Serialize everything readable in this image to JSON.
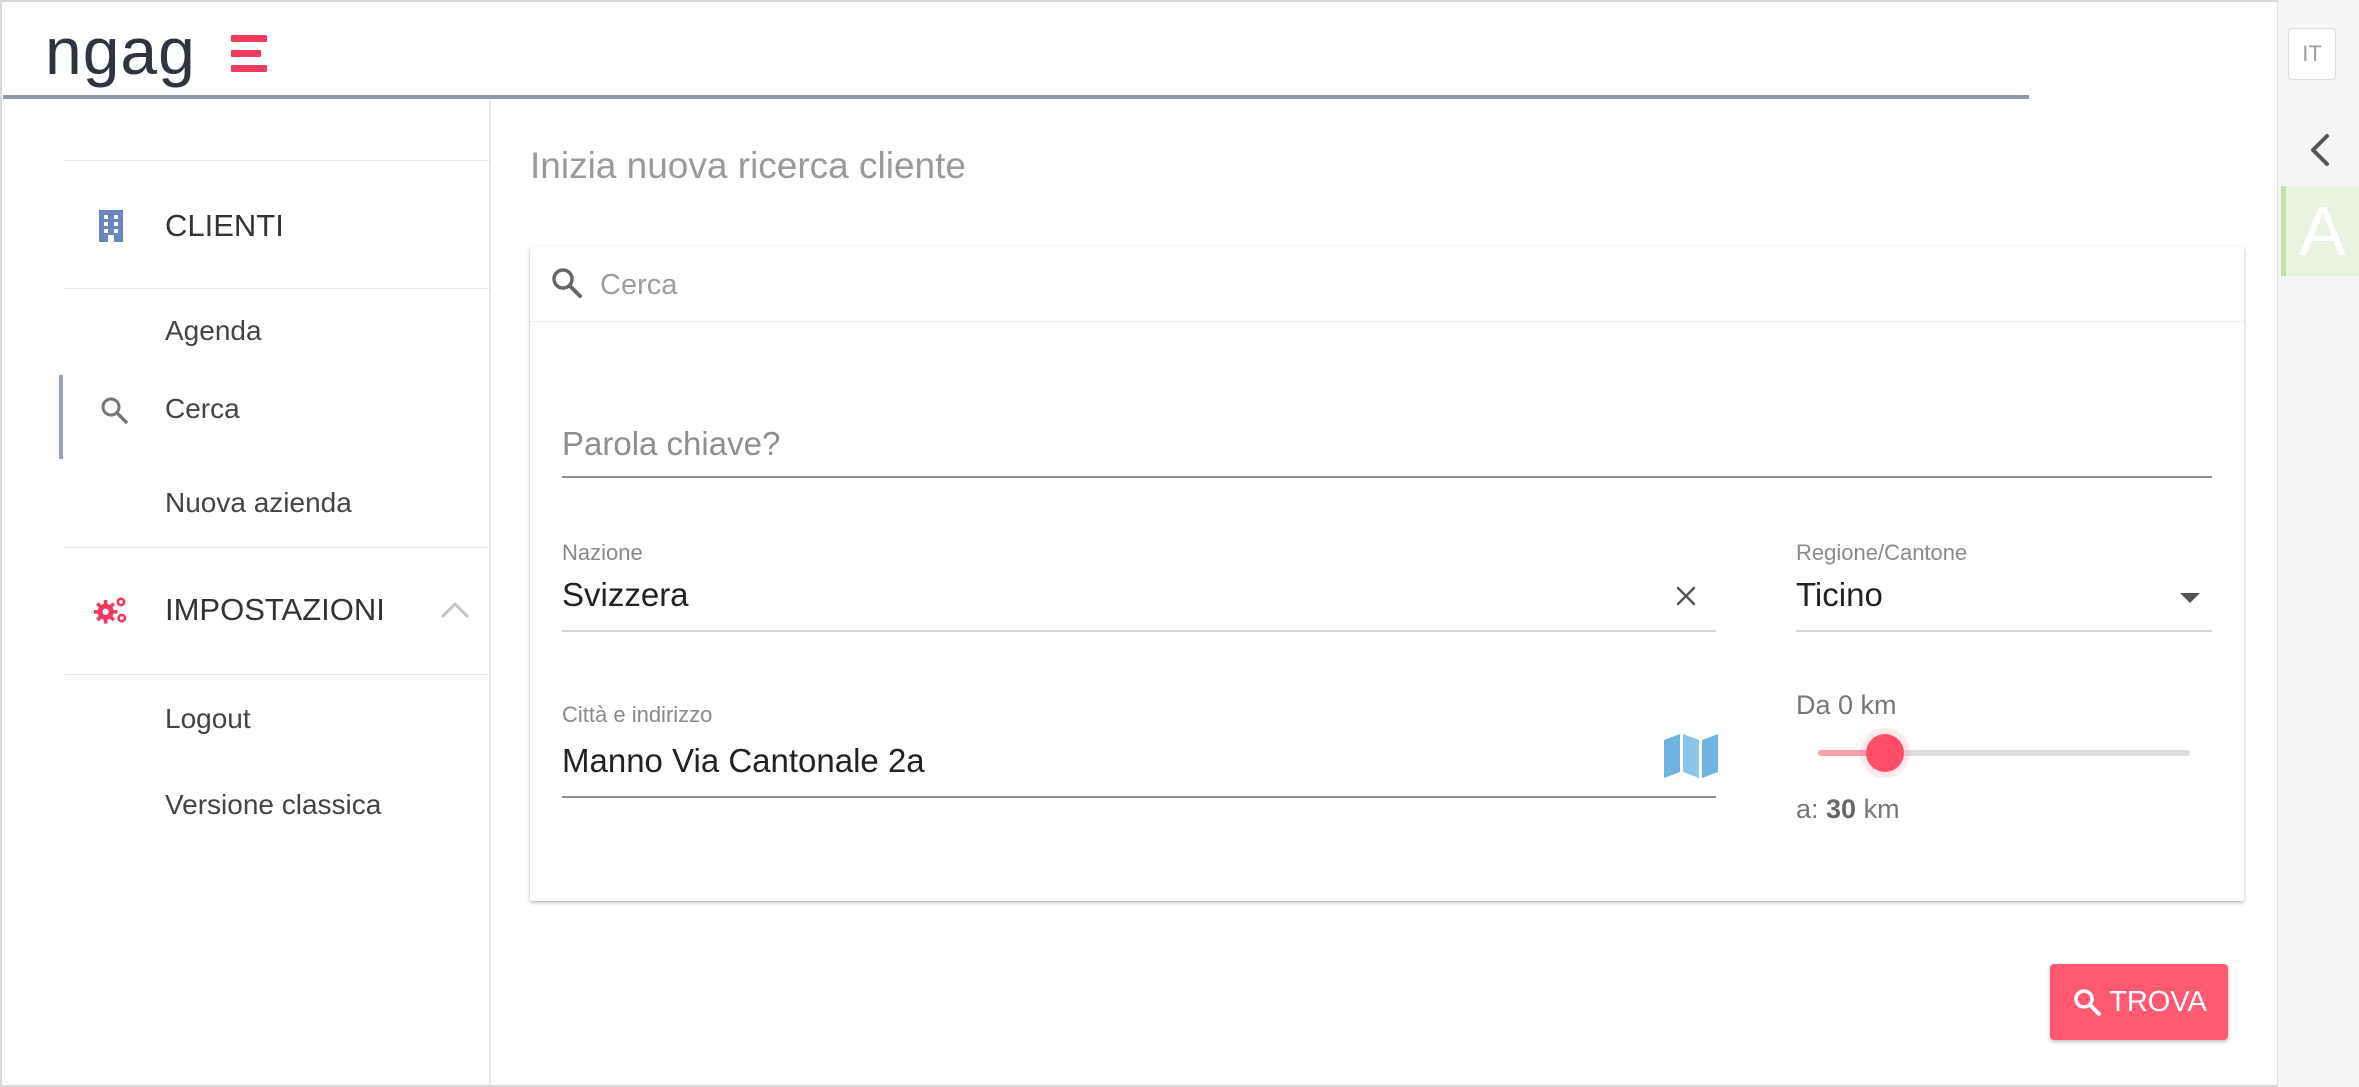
{
  "header": {
    "logo_text": "ngag",
    "language": "IT",
    "avatar_letter": "A"
  },
  "sidebar": {
    "clienti": {
      "label": "CLIENTI",
      "icon": "building-icon",
      "items": [
        {
          "label": "Agenda"
        },
        {
          "label": "Cerca",
          "icon": "search-icon",
          "active": true
        },
        {
          "label": "Nuova azienda"
        }
      ]
    },
    "impostazioni": {
      "label": "IMPOSTAZIONI",
      "icon": "gears-icon",
      "expanded": true,
      "items": [
        {
          "label": "Logout"
        },
        {
          "label": "Versione classica"
        }
      ]
    }
  },
  "main": {
    "title": "Inizia nuova ricerca cliente",
    "search": {
      "placeholder": "Cerca",
      "value": ""
    },
    "keyword": {
      "placeholder": "Parola chiave?",
      "value": ""
    },
    "nazione": {
      "label": "Nazione",
      "value": "Svizzera"
    },
    "regione": {
      "label": "Regione/Cantone",
      "value": "Ticino"
    },
    "indirizzo": {
      "label": "Città e indirizzo",
      "value": "Manno Via Cantonale 2a"
    },
    "range": {
      "from_label": "Da 0 km",
      "to_prefix": "a: ",
      "to_value": "30",
      "to_unit": " km",
      "fraction": 0.18
    },
    "trova_button": "TROVA"
  },
  "colors": {
    "accent": "#ff5a72",
    "logo_accent": "#ef3a5d",
    "header_border": "#8e99ad",
    "icon_blue": "#6c86c1",
    "map_blue": "#6fb3e0"
  }
}
